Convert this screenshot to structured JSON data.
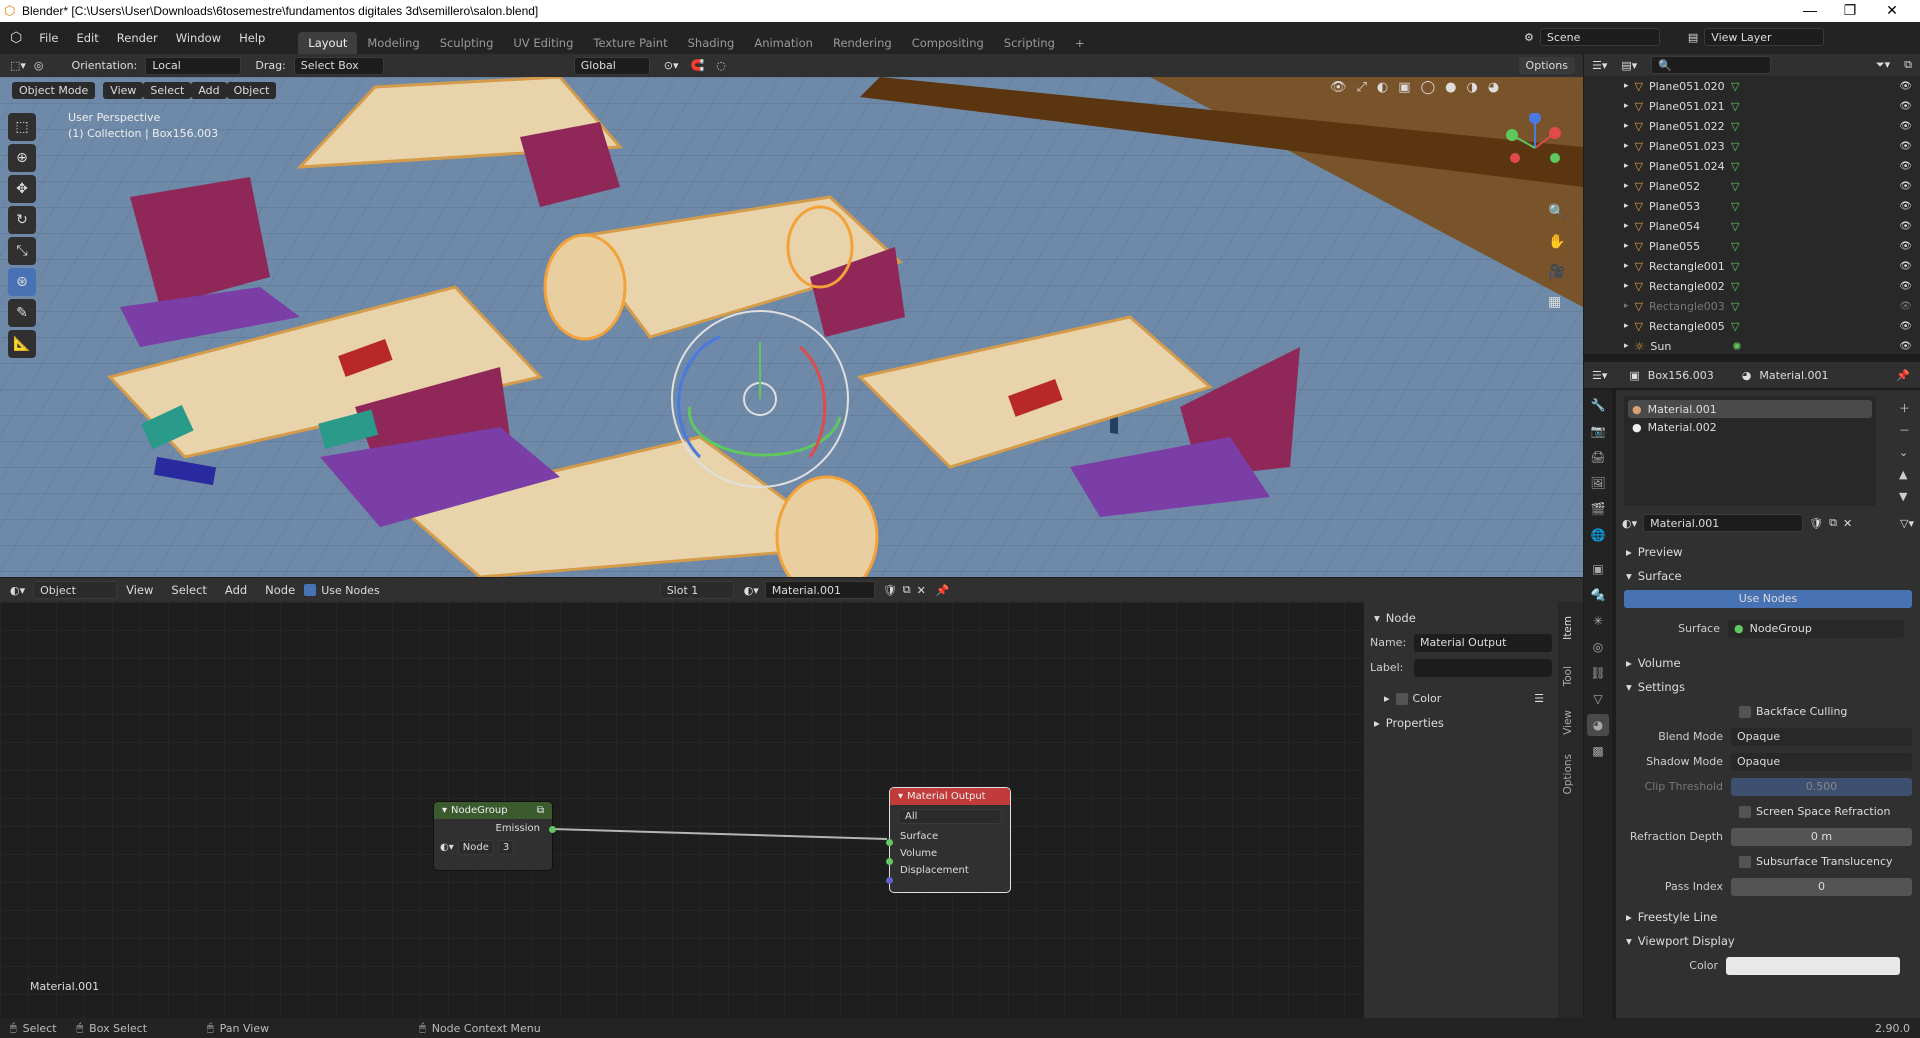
{
  "window": {
    "title": "Blender* [C:\\Users\\User\\Downloads\\6tosemestre\\fundamentos digitales 3d\\semillero\\salon.blend]",
    "minimize": "—",
    "maximize": "❐",
    "close": "✕"
  },
  "menubar": {
    "items": [
      "File",
      "Edit",
      "Render",
      "Window",
      "Help"
    ],
    "tabs": [
      "Layout",
      "Modeling",
      "Sculpting",
      "UV Editing",
      "Texture Paint",
      "Shading",
      "Animation",
      "Rendering",
      "Compositing",
      "Scripting"
    ],
    "add_tab": "+",
    "scene": "Scene",
    "view_layer": "View Layer"
  },
  "viewport_header": {
    "orientation_label": "Orientation:",
    "orientation": "Local",
    "drag_label": "Drag:",
    "drag": "Select Box",
    "transform": "Global",
    "options": "Options",
    "mode": "Object Mode",
    "menus": [
      "View",
      "Select",
      "Add",
      "Object"
    ]
  },
  "viewport": {
    "perspective": "User Perspective",
    "collection": "(1) Collection | Box156.003"
  },
  "node_header": {
    "editor": "Object",
    "menus": [
      "View",
      "Select",
      "Add",
      "Node"
    ],
    "use_nodes": "Use Nodes",
    "slot": "Slot 1",
    "material": "Material.001"
  },
  "nodegroup": {
    "title": "NodeGroup",
    "output": "Emission",
    "node_label": "Node",
    "users": "3"
  },
  "material_output": {
    "title": "Material Output",
    "target": "All",
    "inputs": [
      "Surface",
      "Volume",
      "Displacement"
    ]
  },
  "node_editor_material": "Material.001",
  "npanel": {
    "section": "Node",
    "name_label": "Name:",
    "name": "Material Output",
    "label_label": "Label:",
    "label": "",
    "color": "Color",
    "properties": "Properties",
    "tabs": [
      "Item",
      "Tool",
      "View",
      "Options"
    ]
  },
  "outliner": {
    "items": [
      {
        "name": "Plane051.020",
        "faded": false
      },
      {
        "name": "Plane051.021",
        "faded": false
      },
      {
        "name": "Plane051.022",
        "faded": false
      },
      {
        "name": "Plane051.023",
        "faded": false
      },
      {
        "name": "Plane051.024",
        "faded": false
      },
      {
        "name": "Plane052",
        "faded": false
      },
      {
        "name": "Plane053",
        "faded": false
      },
      {
        "name": "Plane054",
        "faded": false
      },
      {
        "name": "Plane055",
        "faded": false
      },
      {
        "name": "Rectangle001",
        "faded": false
      },
      {
        "name": "Rectangle002",
        "faded": false
      },
      {
        "name": "Rectangle003",
        "faded": true
      },
      {
        "name": "Rectangle005",
        "faded": false
      },
      {
        "name": "Sun",
        "faded": false
      }
    ]
  },
  "properties": {
    "object": "Box156.003",
    "material_tab": "Material.001",
    "slots": [
      "Material.001",
      "Material.002"
    ],
    "material": "Material.001",
    "sections": {
      "preview": "Preview",
      "surface": "Surface",
      "volume": "Volume",
      "settings": "Settings",
      "freestyle": "Freestyle Line",
      "viewport": "Viewport Display"
    },
    "use_nodes": "Use Nodes",
    "surface_label": "Surface",
    "surface_value": "NodeGroup",
    "backface": "Backface Culling",
    "blend_label": "Blend Mode",
    "blend": "Opaque",
    "shadow_label": "Shadow Mode",
    "shadow": "Opaque",
    "clip_label": "Clip Threshold",
    "clip": "0.500",
    "ssr": "Screen Space Refraction",
    "refr_label": "Refraction Depth",
    "refr": "0 m",
    "sss": "Subsurface Translucency",
    "pass_label": "Pass Index",
    "pass": "0",
    "color_label": "Color"
  },
  "statusbar": {
    "select": "Select",
    "box_select": "Box Select",
    "pan": "Pan View",
    "context": "Node Context Menu",
    "version": "2.90.0"
  },
  "colors": {
    "accent": "#4772b3",
    "output_header": "#c23b3b",
    "nodegroup_header": "#3b5b2f",
    "socket_green": "#63c763",
    "socket_purple": "#6363c7"
  }
}
